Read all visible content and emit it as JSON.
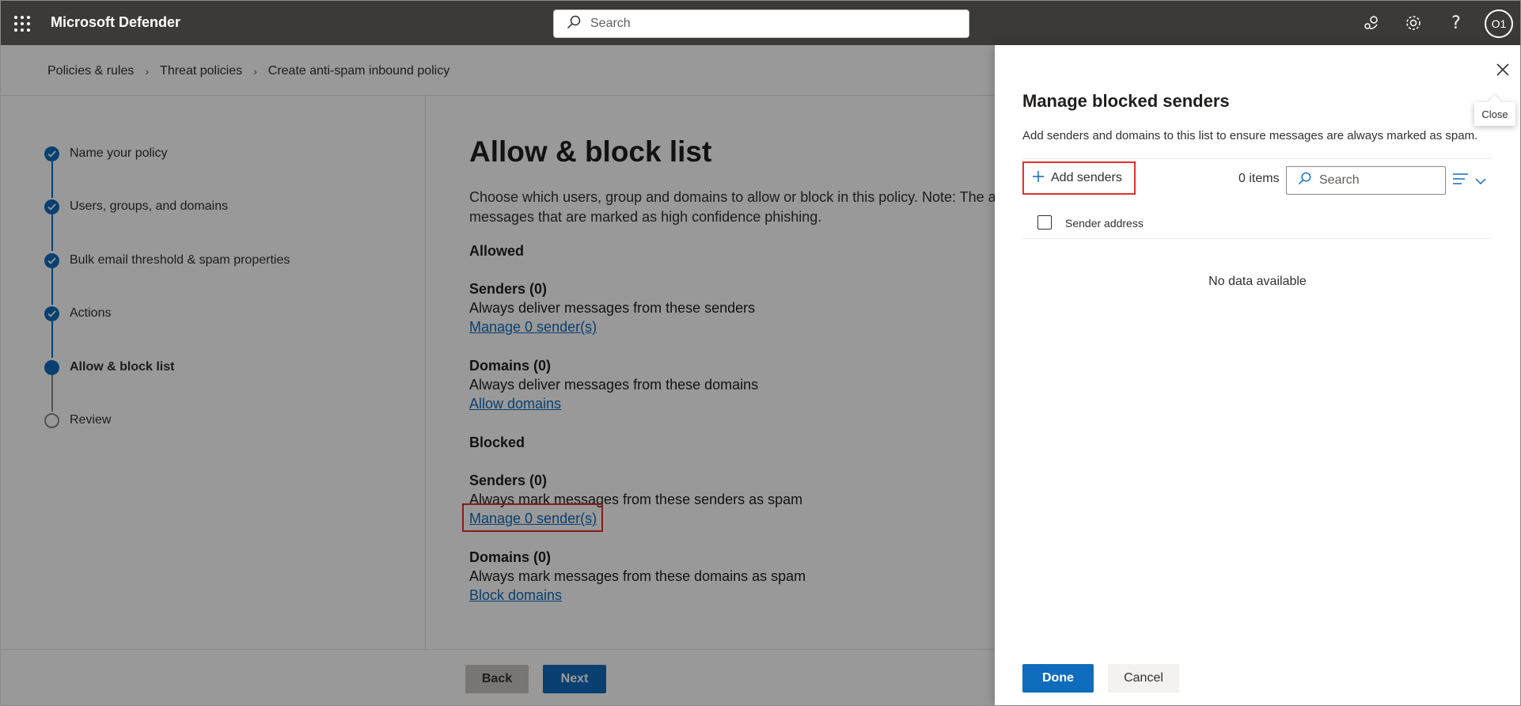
{
  "app": {
    "title": "Microsoft Defender",
    "avatar_initials": "O1"
  },
  "search": {
    "placeholder": "Search"
  },
  "breadcrumb": [
    "Policies & rules",
    "Threat policies",
    "Create anti-spam inbound policy"
  ],
  "steps": [
    {
      "label": "Name your policy",
      "state": "complete"
    },
    {
      "label": "Users, groups, and domains",
      "state": "complete"
    },
    {
      "label": "Bulk email threshold & spam properties",
      "state": "complete"
    },
    {
      "label": "Actions",
      "state": "complete"
    },
    {
      "label": "Allow & block list",
      "state": "current"
    },
    {
      "label": "Review",
      "state": "pending"
    }
  ],
  "main": {
    "title": "Allow & block list",
    "description": "Choose which users, group and domains to allow or block in this policy. Note: The a messages that are marked as high confidence phishing.",
    "allowed": {
      "heading": "Allowed",
      "senders_title": "Senders (0)",
      "senders_desc": "Always deliver messages from these senders",
      "senders_link": "Manage 0 sender(s)",
      "domains_title": "Domains (0)",
      "domains_desc": "Always deliver messages from these domains",
      "domains_link": "Allow domains"
    },
    "blocked": {
      "heading": "Blocked",
      "senders_title": "Senders (0)",
      "senders_desc": "Always mark messages from these senders as spam",
      "senders_link": "Manage 0 sender(s)",
      "domains_title": "Domains (0)",
      "domains_desc": "Always mark messages from these domains as spam",
      "domains_link": "Block domains"
    },
    "back_label": "Back",
    "next_label": "Next"
  },
  "panel": {
    "title": "Manage blocked senders",
    "description": "Add senders and domains to this list to ensure messages are always marked as spam.",
    "add_label": "Add senders",
    "items_count": "0 items",
    "search_placeholder": "Search",
    "column_header": "Sender address",
    "empty_text": "No data available",
    "done_label": "Done",
    "cancel_label": "Cancel",
    "close_tooltip": "Close"
  },
  "colors": {
    "accent": "#0f6cbd",
    "highlight": "#e0312f",
    "topbar": "#3b3a39"
  }
}
